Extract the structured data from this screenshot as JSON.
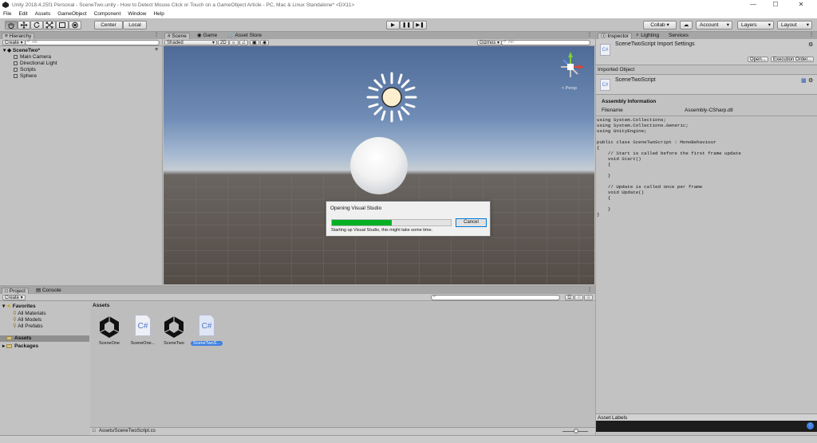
{
  "window": {
    "title": "Unity 2018.4.25f1 Personal - SceneTwo.unity - How to Detect Mouse Click or Touch on a GameObject Article - PC, Mac & Linux Standalone* <DX11>",
    "controls": [
      "—",
      "☐",
      "✕"
    ]
  },
  "menu": [
    "File",
    "Edit",
    "Assets",
    "GameObject",
    "Component",
    "Window",
    "Help"
  ],
  "toolbar": {
    "pivot": "Center",
    "space": "Local",
    "collab": "Collab ▾",
    "account": "Account",
    "layers": "Layers",
    "layout": "Layout"
  },
  "hierarchy": {
    "tab": "Hierarchy",
    "create": "Create ▾",
    "search_placeholder": "All",
    "scene": "SceneTwo*",
    "items": [
      "Main Camera",
      "Directional Light",
      "Scripts",
      "Sphere"
    ]
  },
  "scene_tabs": [
    "Scene",
    "Game",
    "Asset Store"
  ],
  "scene_bar": {
    "shading": "Shaded",
    "mode2d": "2D",
    "gizmos": "Gizmos ▾",
    "search_placeholder": "All"
  },
  "gizmo": {
    "persp": "< Persp"
  },
  "dialog": {
    "title": "Opening Visual Studio",
    "progress": 0.5,
    "message": "Starting up Visual Studio, this might take some time.",
    "cancel": "Cancel"
  },
  "project": {
    "tabs": [
      "Project",
      "Console"
    ],
    "create": "Create ▾",
    "favorites": "Favorites",
    "favorite_items": [
      "All Materials",
      "All Models",
      "All Prefabs"
    ],
    "assets": "Assets",
    "packages": "Packages",
    "assets_header": "Assets",
    "files": [
      "SceneOne",
      "SceneOne...",
      "SceneTwo",
      "SceneTwoS..."
    ],
    "path": "Assets/SceneTwoScript.cs"
  },
  "inspector": {
    "tabs": [
      "Inspector",
      "Lighting",
      "Services"
    ],
    "import_title": "SceneTwoScript Import Settings",
    "open": "Open...",
    "exec_order": "Execution Order...",
    "imported_object": "Imported Object",
    "script_name": "SceneTwoScript",
    "assembly_info": "Assembly Information",
    "filename_label": "Filename",
    "filename_value": "Assembly-CSharp.dll",
    "code": "using System.Collections;\nusing System.Collections.Generic;\nusing UnityEngine;\n\npublic class SceneTwoScript : MonoBehaviour\n{\n    // Start is called before the first frame update\n    void Start()\n    {\n\n    }\n\n    // Update is called once per frame\n    void Update()\n    {\n\n    }\n}",
    "asset_labels": "Asset Labels"
  },
  "colors": {
    "progress": "#06b025",
    "selection": "#3d80df"
  }
}
